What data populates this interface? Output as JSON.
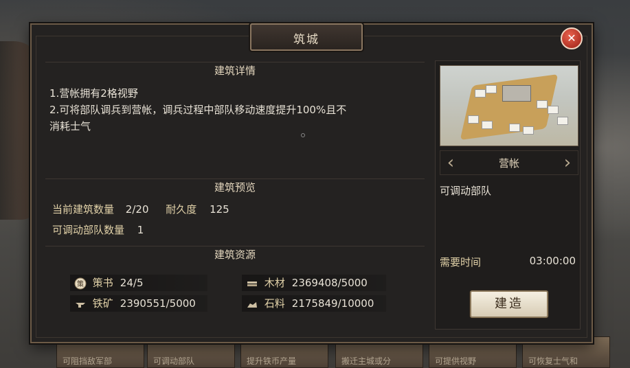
{
  "dialog": {
    "title": "筑城",
    "close_icon": "close-icon"
  },
  "details": {
    "heading": "建筑详情",
    "lines": [
      "1.营帐拥有2格视野",
      "2.可将部队调兵到营帐，调兵过程中部队移动速度提升100%且不",
      "消耗士气"
    ]
  },
  "preview_section": {
    "heading": "建筑预览",
    "count_label": "当前建筑数量",
    "count_value": "2/20",
    "durability_label": "耐久度",
    "durability_value": "125",
    "troops_label": "可调动部队数量",
    "troops_value": "1"
  },
  "resources": {
    "heading": "建筑资源",
    "items": [
      {
        "icon": "strategy-book-icon",
        "label": "策书",
        "value": "24/5"
      },
      {
        "icon": "wood-icon",
        "label": "木材",
        "value": "2369408/5000"
      },
      {
        "icon": "iron-ore-icon",
        "label": "铁矿",
        "value": "2390551/5000"
      },
      {
        "icon": "stone-icon",
        "label": "石料",
        "value": "2175849/10000"
      }
    ]
  },
  "building": {
    "name": "营帐",
    "description": "可调动部队",
    "time_label": "需要时间",
    "time_value": "03:00:00",
    "build_label": "建造"
  },
  "background": {
    "cards": [
      "可阻挡敌军部",
      "可调动部队",
      "提升铁币产量",
      "搬迁主城或分",
      "可提供视野",
      "可恢复士气和"
    ]
  }
}
